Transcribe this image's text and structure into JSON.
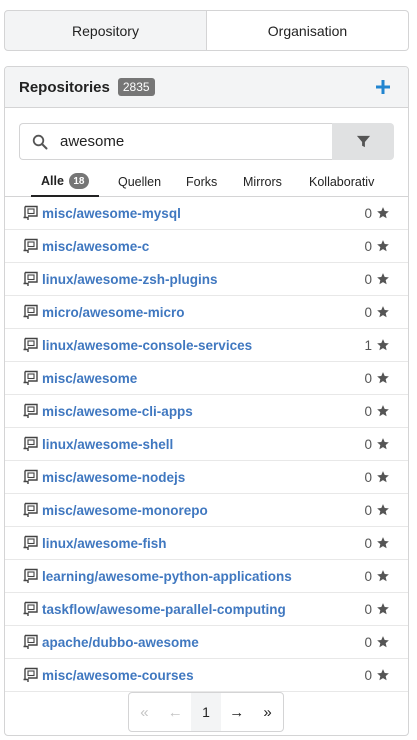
{
  "tabs": {
    "repository": "Repository",
    "organisation": "Organisation"
  },
  "panel": {
    "title": "Repositories",
    "total_count": "2835",
    "add_icon": "plus-icon"
  },
  "search": {
    "value": "awesome",
    "icon": "search-icon",
    "filter_icon": "filter-icon"
  },
  "subtabs": {
    "alle": "Alle",
    "alle_count": "18",
    "quellen": "Quellen",
    "forks": "Forks",
    "mirrors": "Mirrors",
    "kollaborativ": "Kollaborativ"
  },
  "repos": [
    {
      "name": "misc/awesome-mysql",
      "stars": "0"
    },
    {
      "name": "misc/awesome-c",
      "stars": "0"
    },
    {
      "name": "linux/awesome-zsh-plugins",
      "stars": "0"
    },
    {
      "name": "micro/awesome-micro",
      "stars": "0"
    },
    {
      "name": "linux/awesome-console-services",
      "stars": "1"
    },
    {
      "name": "misc/awesome",
      "stars": "0"
    },
    {
      "name": "misc/awesome-cli-apps",
      "stars": "0"
    },
    {
      "name": "linux/awesome-shell",
      "stars": "0"
    },
    {
      "name": "misc/awesome-nodejs",
      "stars": "0"
    },
    {
      "name": "misc/awesome-monorepo",
      "stars": "0"
    },
    {
      "name": "linux/awesome-fish",
      "stars": "0"
    },
    {
      "name": "learning/awesome-python-applications",
      "stars": "0"
    },
    {
      "name": "taskflow/awesome-parallel-computing",
      "stars": "0"
    },
    {
      "name": "apache/dubbo-awesome",
      "stars": "0"
    },
    {
      "name": "misc/awesome-courses",
      "stars": "0"
    }
  ],
  "pagination": {
    "first": "«",
    "prev": "←",
    "current": "1",
    "next": "→",
    "last": "»"
  },
  "colors": {
    "link": "#4078c0",
    "accent": "#2185d0",
    "badge": "#767676"
  }
}
